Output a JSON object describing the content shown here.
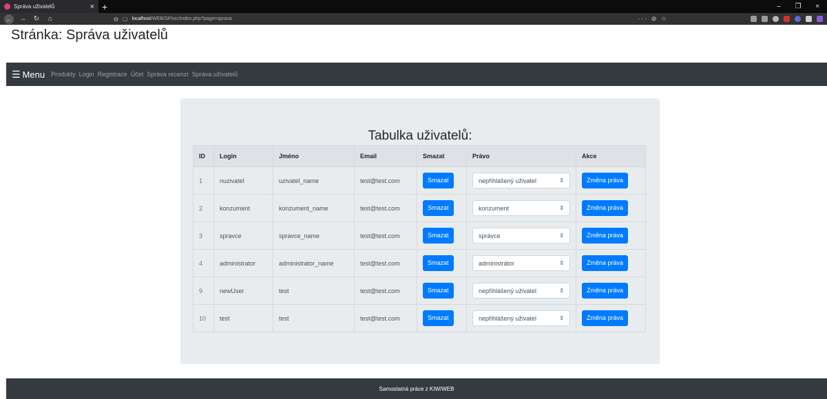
{
  "browser": {
    "tab_title": "Správa uživatelů",
    "url_host": "localhost",
    "url_path": "/WEB/SP/src/index.php?page=sprava",
    "url_actions": "··· ⊘ ☆"
  },
  "page": {
    "title": "Stránka: Správa uživatelů"
  },
  "nav": {
    "menu_label": "Menu",
    "links": [
      "Produkty",
      "Login",
      "Registrace",
      "Účet",
      "Správa recenzí",
      "Správa uživatelů"
    ]
  },
  "table": {
    "title": "Tabulka uživatelů:",
    "headers": [
      "ID",
      "Login",
      "Jméno",
      "Email",
      "Smazat",
      "Právo",
      "Akce"
    ],
    "delete_label": "Smazat",
    "change_label": "Změna práva",
    "rows": [
      {
        "id": "1",
        "login": "nuzivatel",
        "name": "uzivatel_name",
        "email": "test@test.com",
        "role": "nepřihlášený uživatel"
      },
      {
        "id": "2",
        "login": "konzument",
        "name": "konzument_name",
        "email": "test@test.com",
        "role": "konzument"
      },
      {
        "id": "3",
        "login": "spravce",
        "name": "spravce_name",
        "email": "test@test.com",
        "role": "správce"
      },
      {
        "id": "4",
        "login": "administrator",
        "name": "administrator_name",
        "email": "test@test.com",
        "role": "administrátor"
      },
      {
        "id": "9",
        "login": "newUser",
        "name": "test",
        "email": "test@test.com",
        "role": "nepřihlášený uživatel"
      },
      {
        "id": "10",
        "login": "test",
        "name": "test",
        "email": "test@test.com",
        "role": "nepřihlášený uživatel"
      }
    ]
  },
  "footer": {
    "text": "Samostatná práce z KIW/WEB"
  },
  "colors": {
    "primary": "#007bff",
    "dark": "#343a40",
    "panel": "#e9ecef"
  }
}
